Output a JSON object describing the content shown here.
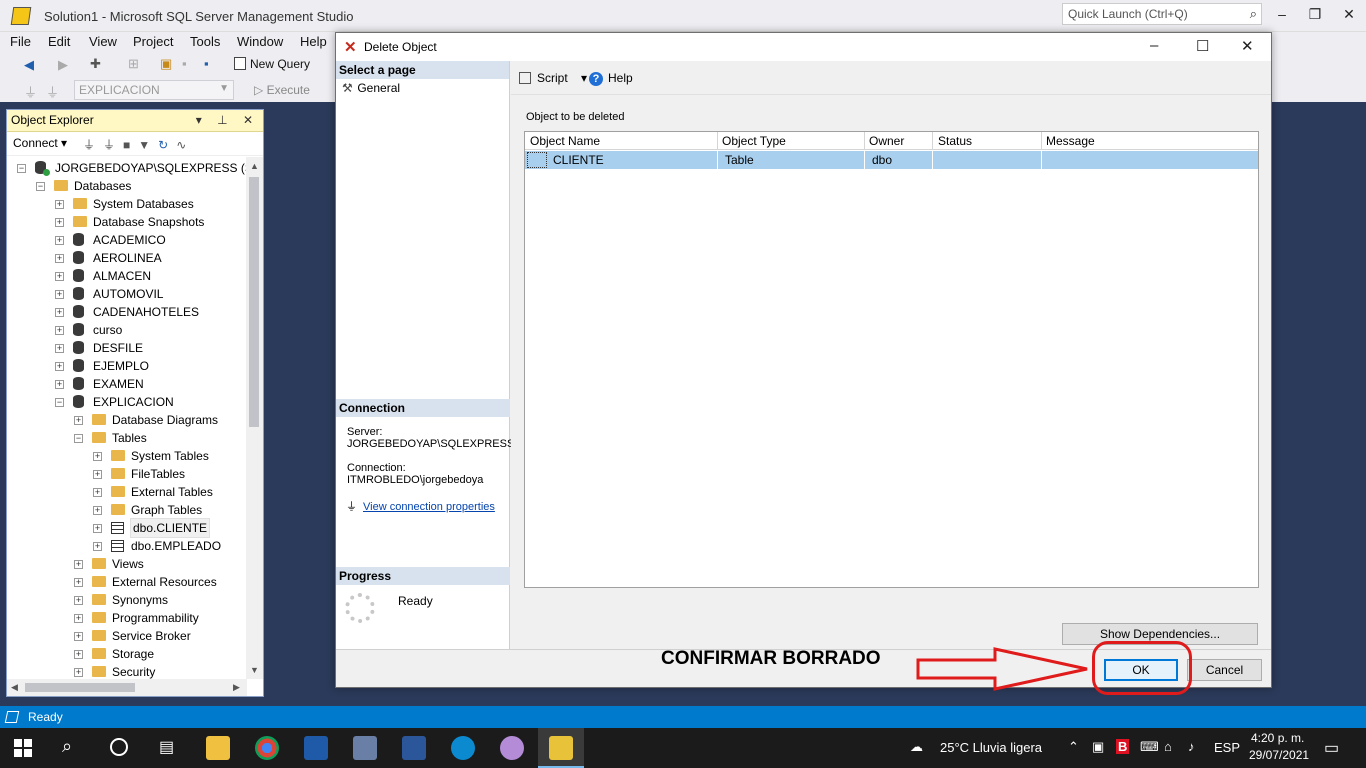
{
  "window": {
    "title": "Solution1 - Microsoft SQL Server Management Studio",
    "quick_launch_placeholder": "Quick Launch (Ctrl+Q)",
    "controls": [
      "–",
      "❐",
      "✕"
    ]
  },
  "menu": [
    "File",
    "Edit",
    "View",
    "Project",
    "Tools",
    "Window",
    "Help"
  ],
  "toolbar": {
    "new_query": "New Query",
    "database": "EXPLICACION",
    "execute": "Execute"
  },
  "object_explorer": {
    "title": "Object Explorer",
    "connect": "Connect",
    "tree": [
      {
        "label": "JORGEBEDOYAP\\SQLEXPRESS (SQL S",
        "level": 0,
        "icon": "server",
        "expanded": true
      },
      {
        "label": "Databases",
        "level": 1,
        "icon": "folder",
        "expanded": true
      },
      {
        "label": "System Databases",
        "level": 2,
        "icon": "folder",
        "expanded": false
      },
      {
        "label": "Database Snapshots",
        "level": 2,
        "icon": "folder",
        "expanded": false
      },
      {
        "label": "ACADEMICO",
        "level": 2,
        "icon": "db",
        "expanded": false
      },
      {
        "label": "AEROLINEA",
        "level": 2,
        "icon": "db",
        "expanded": false
      },
      {
        "label": "ALMACEN",
        "level": 2,
        "icon": "db",
        "expanded": false
      },
      {
        "label": "AUTOMOVIL",
        "level": 2,
        "icon": "db",
        "expanded": false
      },
      {
        "label": "CADENAHOTELES",
        "level": 2,
        "icon": "db",
        "expanded": false
      },
      {
        "label": "curso",
        "level": 2,
        "icon": "db",
        "expanded": false
      },
      {
        "label": "DESFILE",
        "level": 2,
        "icon": "db",
        "expanded": false
      },
      {
        "label": "EJEMPLO",
        "level": 2,
        "icon": "db",
        "expanded": false
      },
      {
        "label": "EXAMEN",
        "level": 2,
        "icon": "db",
        "expanded": false
      },
      {
        "label": "EXPLICACION",
        "level": 2,
        "icon": "db",
        "expanded": true
      },
      {
        "label": "Database Diagrams",
        "level": 3,
        "icon": "folder",
        "expanded": false
      },
      {
        "label": "Tables",
        "level": 3,
        "icon": "folder",
        "expanded": true
      },
      {
        "label": "System Tables",
        "level": 4,
        "icon": "folder",
        "expanded": false
      },
      {
        "label": "FileTables",
        "level": 4,
        "icon": "folder",
        "expanded": false
      },
      {
        "label": "External Tables",
        "level": 4,
        "icon": "folder",
        "expanded": false
      },
      {
        "label": "Graph Tables",
        "level": 4,
        "icon": "folder",
        "expanded": false
      },
      {
        "label": "dbo.CLIENTE",
        "level": 4,
        "icon": "table",
        "expanded": false,
        "selected": true
      },
      {
        "label": "dbo.EMPLEADO",
        "level": 4,
        "icon": "table",
        "expanded": false
      },
      {
        "label": "Views",
        "level": 3,
        "icon": "folder",
        "expanded": false
      },
      {
        "label": "External Resources",
        "level": 3,
        "icon": "folder",
        "expanded": false
      },
      {
        "label": "Synonyms",
        "level": 3,
        "icon": "folder",
        "expanded": false
      },
      {
        "label": "Programmability",
        "level": 3,
        "icon": "folder",
        "expanded": false
      },
      {
        "label": "Service Broker",
        "level": 3,
        "icon": "folder",
        "expanded": false
      },
      {
        "label": "Storage",
        "level": 3,
        "icon": "folder",
        "expanded": false
      },
      {
        "label": "Security",
        "level": 3,
        "icon": "folder",
        "expanded": false
      }
    ]
  },
  "dialog": {
    "title": "Delete Object",
    "select_page": "Select a page",
    "pages": [
      "General"
    ],
    "script": "Script",
    "help": "Help",
    "objects_label": "Object to be deleted",
    "columns": [
      "Object Name",
      "Object Type",
      "Owner",
      "Status",
      "Message"
    ],
    "rows": [
      {
        "name": "CLIENTE",
        "type": "Table",
        "owner": "dbo",
        "status": "",
        "message": ""
      }
    ],
    "connection_head": "Connection",
    "server_label": "Server:",
    "server_value": "JORGEBEDOYAP\\SQLEXPRESS",
    "connection_label": "Connection:",
    "connection_value": "ITMROBLEDO\\jorgebedoya",
    "view_connection_link": "View connection properties",
    "progress_head": "Progress",
    "progress_status": "Ready",
    "show_dependencies": "Show Dependencies...",
    "ok": "OK",
    "cancel": "Cancel"
  },
  "annotation": {
    "text": "CONFIRMAR BORRADO",
    "color": "#e01b1b"
  },
  "statusbar": {
    "text": "Ready",
    "color": "#007acc"
  },
  "taskbar": {
    "weather": "25°C  Lluvia ligera",
    "lang": "ESP",
    "time": "4:20 p. m.",
    "date": "29/07/2021"
  }
}
